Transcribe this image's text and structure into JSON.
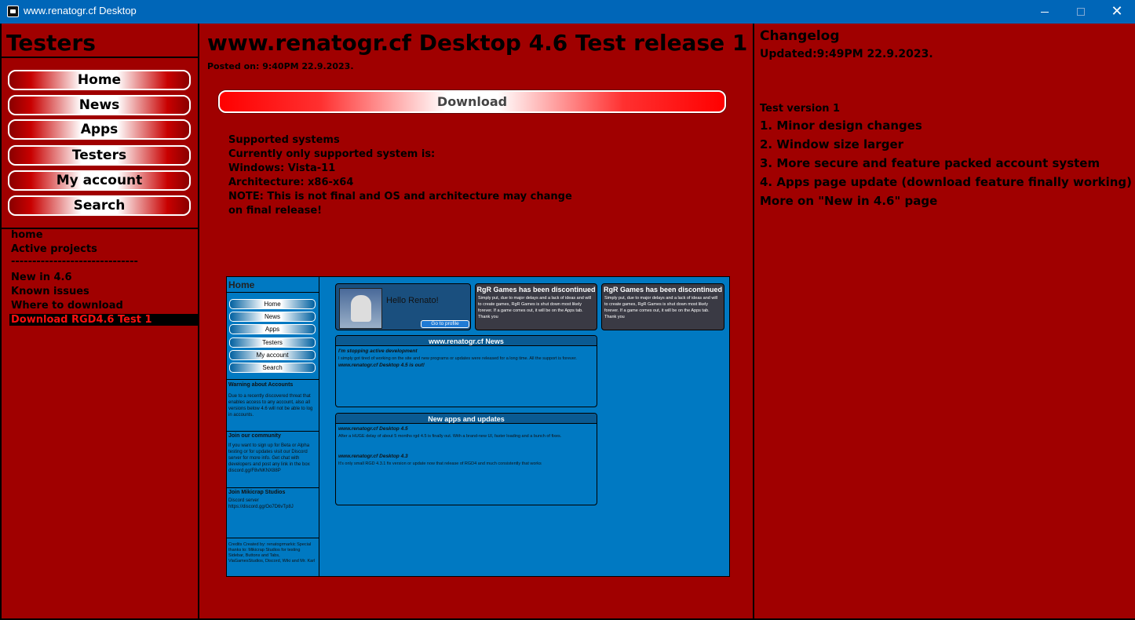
{
  "window": {
    "title": "www.renatogr.cf Desktop",
    "min_label": "",
    "close_label": "✕"
  },
  "sidebar": {
    "heading": "Testers",
    "nav": [
      "Home",
      "News",
      "Apps",
      "Testers",
      "My account",
      "Search"
    ],
    "links": [
      "home",
      "Active projects",
      "------------------------------",
      "New in 4.6",
      "Known issues",
      "Where to download",
      "Download RGD4.6 Test 1"
    ],
    "active_link": "Download RGD4.6 Test 1"
  },
  "main": {
    "title": "www.renatogr.cf Desktop 4.6 Test release 1",
    "posted": "Posted on: 9:40PM 22.9.2023.",
    "download_label": "Download",
    "systems": [
      "Supported systems",
      "Currently only supported system is:",
      "Windows: Vista-11",
      "Architecture: x86-x64",
      "NOTE: This is not final and OS and architecture may change",
      "on final release!"
    ],
    "preview": {
      "sidebar_title": "Home",
      "nav": [
        "Home",
        "News",
        "Apps",
        "Testers",
        "My account",
        "Search"
      ],
      "warning_title": "Warning about Accounts",
      "warning_text": "Due to a recently discovered threat that enables access to any account, also all versions below 4.6 will not be able to log in accounts.",
      "community_title": "Join our community",
      "community_text": "If you want to sign up for Beta or Alpha testing or for updates visit our Discord server for more info. Get chat with developers and post any link in the box discord.gg/F8vNKNX88P",
      "mikicrap_title": "Join Mikicrap Studios",
      "mikicrap_text": "Discord server https://discord.gg/Oo7D6vTp8J",
      "credits_text": "Credits Created by: renatogrmarkic Special thanks to: Mikicrap Studios for testing Sidebar, Buttons and Tabs, ViaGamesStudios, Discord, Wiki and Mr. Karl",
      "hello": "Hello Renato!",
      "profile_btn": "Go to profile",
      "disc_title": "RgR Games has been discontinued",
      "disc_text": "Simply put, due to major delays and a lack of ideas and will to create games, RgR Games is shut down most likely forever. If a game comes out, it will be on the Apps tab. Thank you",
      "news_title": "www.renatogr.cf News",
      "news_sub": "I'm stopping active development",
      "news_text": "I simply got tired of working on the site and new programs or updates were released for a long time. All the support is forever.",
      "news_sub2": "www.renatogr.cf Desktop 4.5 is out!",
      "apps_title": "New apps and updates",
      "apps_sub1": "www.renatogr.cf Desktop 4.5",
      "apps_text1": "After a HUGE delay of about 5 months rgd 4.5 is finally out. With a brand-new UI, faster loading and a bunch of fixes.",
      "apps_sub2": "www.renatogr.cf Desktop 4.3",
      "apps_text2": "It's only small RGD 4.3.1 fix version or update now that release of RGD4 and much consistently that works"
    }
  },
  "changelog": {
    "heading": "Changelog",
    "updated": "Updated:9:49PM 22.9.2023.",
    "version_label": "Test version 1",
    "items": [
      "1. Minor design changes",
      "2. Window size larger",
      "3. More secure and feature packed account system",
      "4. Apps page update (download feature finally working)",
      "More on \"New in 4.6\" page"
    ]
  },
  "colors": {
    "background": "#a00000",
    "titlebar": "#0066b8",
    "preview_bg": "#0079c2",
    "active_link_text": "#ff1010"
  }
}
